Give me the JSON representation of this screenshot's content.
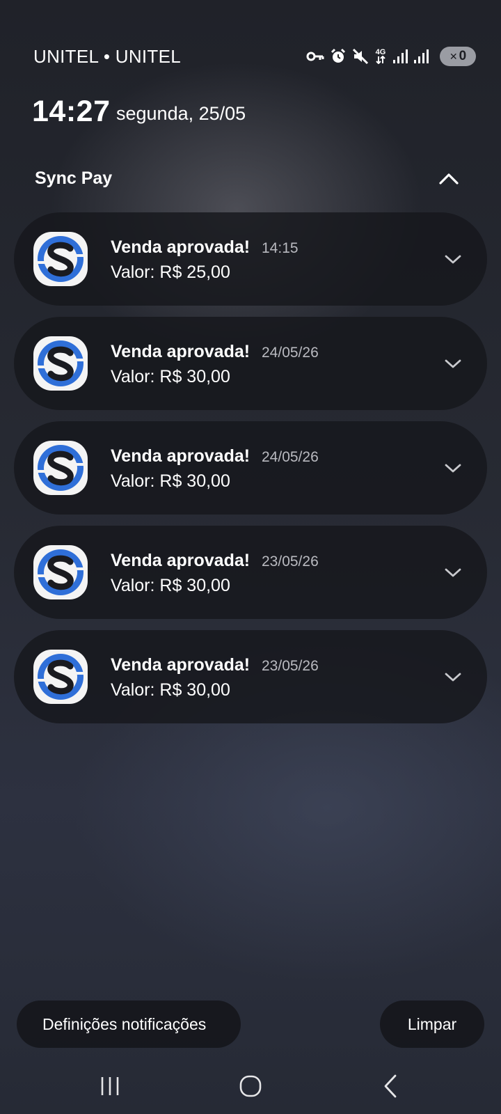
{
  "status_bar": {
    "carrier": "UNITEL • UNITEL",
    "network_type": "4G",
    "battery_level": "0",
    "icons": [
      "vpn-key-icon",
      "alarm-icon",
      "mute-icon",
      "network-4g-icon",
      "signal-icon",
      "signal-icon",
      "battery-charging-icon"
    ]
  },
  "lockscreen": {
    "time": "14:27",
    "date": "segunda, 25/05"
  },
  "group": {
    "app_name": "Sync Pay"
  },
  "notifications": [
    {
      "title": "Venda aprovada!",
      "time": "14:15",
      "body": "Valor: R$ 25,00"
    },
    {
      "title": "Venda aprovada!",
      "time": "24/05/26",
      "body": "Valor: R$ 30,00"
    },
    {
      "title": "Venda aprovada!",
      "time": "24/05/26",
      "body": "Valor: R$ 30,00"
    },
    {
      "title": "Venda aprovada!",
      "time": "23/05/26",
      "body": "Valor: R$ 30,00"
    },
    {
      "title": "Venda aprovada!",
      "time": "23/05/26",
      "body": "Valor: R$ 30,00"
    }
  ],
  "actions": {
    "settings_label": "Definições notificações",
    "clear_label": "Limpar"
  },
  "colors": {
    "app_icon_blue": "#2f6fd8",
    "app_icon_dark": "#1a1b20",
    "card_bg": "#17181d"
  }
}
